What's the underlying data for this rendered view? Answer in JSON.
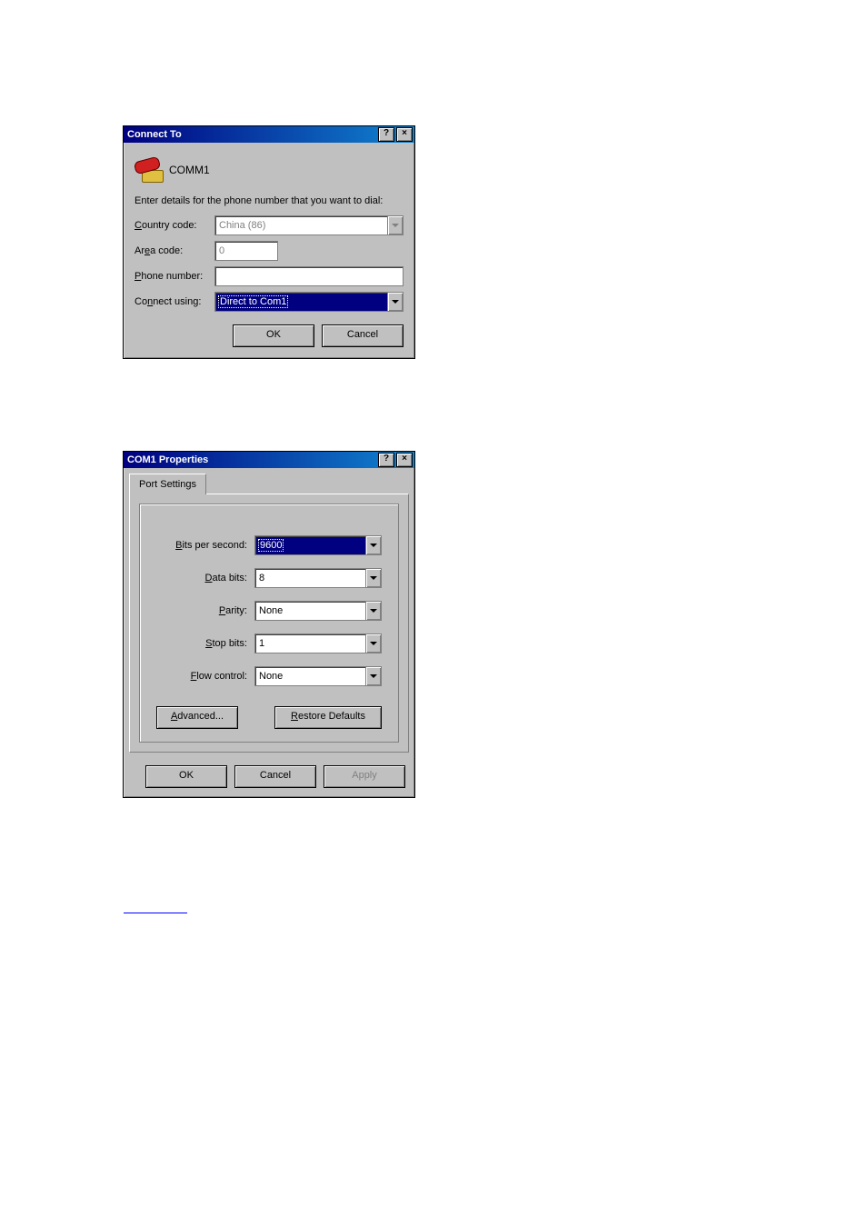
{
  "dialog1": {
    "title": "Connect To",
    "help_btn": "?",
    "close_btn": "×",
    "connection_name": "COMM1",
    "instruction": "Enter details for the phone number that you want to dial:",
    "labels": {
      "country_code_pre": "C",
      "country_code_post": "ountry code:",
      "area_code_pre": "Ar",
      "area_code_u": "e",
      "area_code_post": "a code:",
      "phone_number_pre": "P",
      "phone_number_post": "hone number:",
      "connect_using_pre": "Co",
      "connect_using_u": "n",
      "connect_using_post": "nect using:"
    },
    "values": {
      "country_code": "China (86)",
      "area_code": "0",
      "phone_number": "",
      "connect_using": "Direct to Com1"
    },
    "buttons": {
      "ok": "OK",
      "cancel": "Cancel"
    }
  },
  "dialog2": {
    "title": "COM1 Properties",
    "help_btn": "?",
    "close_btn": "×",
    "tab": "Port Settings",
    "labels": {
      "bps_pre": "B",
      "bps_post": "its per second:",
      "databits_pre": "D",
      "databits_post": "ata bits:",
      "parity_pre": "P",
      "parity_post": "arity:",
      "stopbits_pre": "S",
      "stopbits_post": "top bits:",
      "flow_pre": "F",
      "flow_post": "low control:",
      "advanced_pre": "A",
      "advanced_post": "dvanced...",
      "restore_pre": "R",
      "restore_post": "estore Defaults"
    },
    "values": {
      "bps": "9600",
      "databits": "8",
      "parity": "None",
      "stopbits": "1",
      "flow": "None"
    },
    "buttons": {
      "ok": "OK",
      "cancel": "Cancel",
      "apply": "Apply"
    }
  }
}
